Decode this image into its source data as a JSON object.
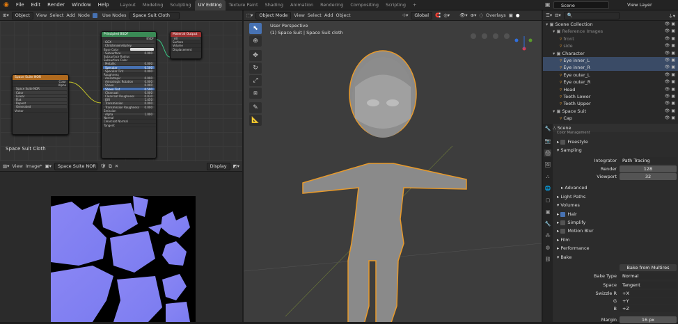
{
  "menu": {
    "file": "File",
    "edit": "Edit",
    "render": "Render",
    "window": "Window",
    "help": "Help"
  },
  "workspaces": [
    "Layout",
    "Modeling",
    "Sculpting",
    "UV Editing",
    "Texture Paint",
    "Shading",
    "Animation",
    "Rendering",
    "Compositing",
    "Scripting",
    "+"
  ],
  "active_workspace": "UV Editing",
  "scene": "Scene",
  "view_layer": "View Layer",
  "node_editor": {
    "mode": "Object",
    "view": "View",
    "select": "Select",
    "add": "Add",
    "node": "Node",
    "use_nodes": "Use Nodes",
    "material": "Space Suit Cloth",
    "label": "Space Suit Cloth"
  },
  "nodes": {
    "bsdf": {
      "title": "Principled BSDF",
      "out": "BSDF",
      "rows": [
        "GGX",
        "Christensen-Burley",
        "Base Color",
        "Subsurface",
        "Subsurface Radius",
        "Subsurface Color",
        "Metallic",
        "Specular",
        "Specular Tint",
        "Roughness",
        "Anisotropic",
        "Anisotropic Rotation",
        "Sheen",
        "Sheen Tint",
        "Clearcoat",
        "Clearcoat Roughness",
        "IOR",
        "Transmission",
        "Transmission Roughness",
        "Emission",
        "Alpha",
        "Normal",
        "Clearcoat Normal",
        "Tangent"
      ],
      "vals": [
        "",
        "",
        "",
        "0.000",
        "",
        "",
        "0.000",
        "0.500",
        "0.000",
        "",
        "0.000",
        "0.000",
        "0.000",
        "0.500",
        "0.000",
        "0.030",
        "1.450",
        "0.000",
        "0.000",
        "",
        "1.000",
        "",
        "",
        ""
      ]
    },
    "output": {
      "title": "Material Output",
      "rows": [
        "All",
        "Surface",
        "Volume",
        "Displacement"
      ]
    },
    "tex": {
      "title": "Space Suite NOR",
      "rows": [
        "Color",
        "Alpha",
        "Space Suite NOR",
        "Color",
        "Linear",
        "Flat",
        "Repeat",
        "Generated",
        "Vector"
      ]
    }
  },
  "image_editor": {
    "view": "View",
    "image": "Image*",
    "image_name": "Space Suite NOR",
    "display": "Display"
  },
  "viewport": {
    "mode": "Object Mode",
    "view": "View",
    "select": "Select",
    "add": "Add",
    "object": "Object",
    "orient": "Global",
    "overlays": "Overlays",
    "persp": "User Perspective",
    "sub": "(1) Space Suit | Space Suit cloth"
  },
  "outliner": {
    "rows": [
      {
        "t": "Scene Collection",
        "d": 0
      },
      {
        "t": "Reference Images",
        "d": 1
      },
      {
        "t": "front",
        "d": 2
      },
      {
        "t": "side",
        "d": 2
      },
      {
        "t": "Character",
        "d": 1
      },
      {
        "t": "Eye inner_L",
        "d": 2
      },
      {
        "t": "Eye inner_R",
        "d": 2
      },
      {
        "t": "Eye outer_L",
        "d": 2
      },
      {
        "t": "Eye outer_R",
        "d": 2
      },
      {
        "t": "Head",
        "d": 2
      },
      {
        "t": "Teeth Lower",
        "d": 2
      },
      {
        "t": "Teeth Upper",
        "d": 2
      },
      {
        "t": "Space Suit",
        "d": 1
      },
      {
        "t": "Cap",
        "d": 2
      }
    ]
  },
  "properties": {
    "scene": "Scene",
    "color_mgmt": "Color Management",
    "freestyle": "Freestyle",
    "sampling": "Sampling",
    "integrator_l": "Integrator",
    "integrator": "Path Tracing",
    "render_l": "Render",
    "render": "128",
    "viewport_l": "Viewport",
    "viewport": "32",
    "advanced": "Advanced",
    "light_paths": "Light Paths",
    "volumes": "Volumes",
    "hair": "Hair",
    "simplify": "Simplify",
    "motion_blur": "Motion Blur",
    "film": "Film",
    "performance": "Performance",
    "bake": "Bake",
    "bake_from": "Bake from Multires",
    "bake_type_l": "Bake Type",
    "bake_type": "Normal",
    "space_l": "Space",
    "space": "Tangent",
    "swizzle_l": "Swizzle R",
    "swizzle_r": "+X",
    "g_l": "G",
    "g": "+Y",
    "b_l": "B",
    "b": "+Z",
    "margin_l": "Margin",
    "margin": "16 px"
  }
}
